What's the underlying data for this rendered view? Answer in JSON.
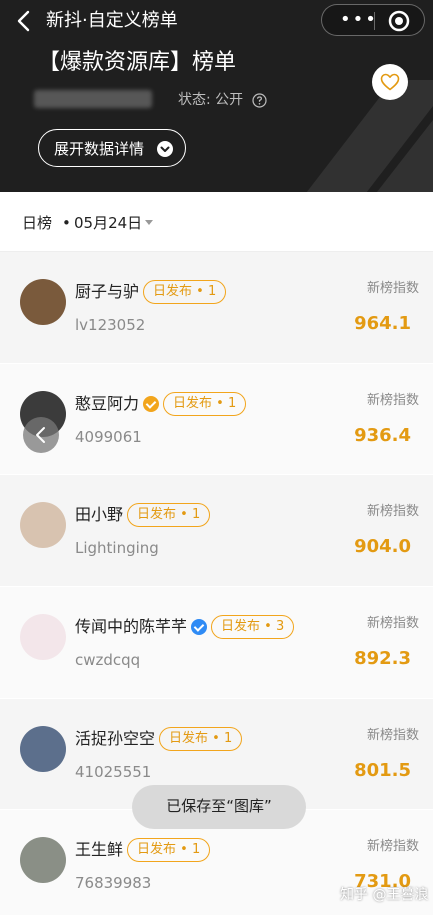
{
  "nav": {
    "title": "新抖·自定义榜单",
    "more_icon": "more-icon",
    "close_icon": "target-icon"
  },
  "header": {
    "list_title": "【爆款资源库】榜单",
    "status_label": "状态: 公开",
    "expand_label": "展开数据详情"
  },
  "filter": {
    "type_label": "日榜",
    "separator": "•",
    "date": "05月24日"
  },
  "index_label": "新榜指数",
  "rows": [
    {
      "name": "厨子与驴",
      "badge": "日发布 • 1",
      "verified": false,
      "handle": "lv123052",
      "index": "964.1",
      "avatar_color": "#7a5a3c"
    },
    {
      "name": "憨豆阿力",
      "badge": "日发布 • 1",
      "verified": true,
      "verify_color": "#f2a51c",
      "handle": "4099061",
      "index": "936.4",
      "avatar_color": "#3b3b3b"
    },
    {
      "name": "田小野",
      "badge": "日发布 • 1",
      "verified": false,
      "handle": "Lightinging",
      "index": "904.0",
      "avatar_color": "#d8c3b0"
    },
    {
      "name": "传闻中的陈芊芊",
      "badge": "日发布 • 3",
      "verified": true,
      "verify_color": "#2f8bf5",
      "handle": "cwzdcqq",
      "index": "892.3",
      "avatar_color": "#f3e6ea"
    },
    {
      "name": "活捉孙空空",
      "badge": "日发布 • 1",
      "verified": false,
      "handle": "41025551",
      "index": "801.5",
      "avatar_color": "#5c6f8c"
    },
    {
      "name": "王生鲜",
      "badge": "日发布 • 1",
      "verified": false,
      "handle": "76839983",
      "index": "731.0",
      "avatar_color": "#8a8f86"
    }
  ],
  "toast": "已保存至“图库”",
  "watermark": "知乎 @王謩浪",
  "colors": {
    "accent": "#e39a12",
    "header_bg": "#1f1f1f"
  }
}
